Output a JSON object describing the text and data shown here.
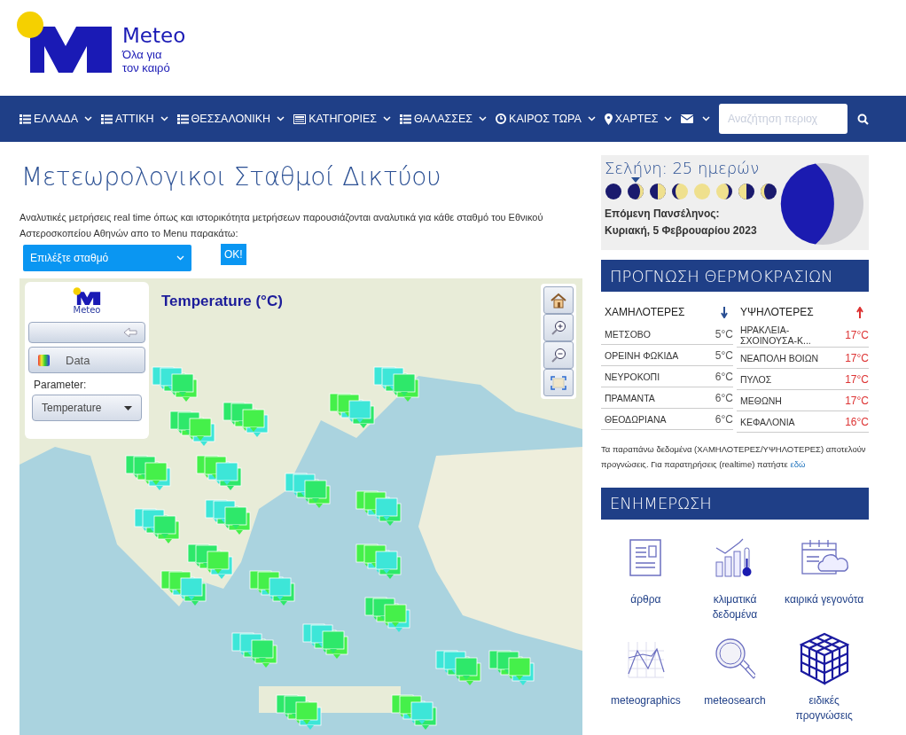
{
  "header": {
    "logo_text": "Meteo",
    "tagline_lines": [
      "Όλα για",
      "τον καιρό"
    ]
  },
  "nav": {
    "items": [
      {
        "kind": "list",
        "label": "ΕΛΛΑΔΑ"
      },
      {
        "kind": "list",
        "label": "ΑΤΤΙΚΗ"
      },
      {
        "kind": "list",
        "label": "ΘΕΣΣΑΛΟΝΙΚΗ"
      },
      {
        "kind": "newspaper",
        "label": "ΚΑΤΗΓΟΡΙΕΣ"
      },
      {
        "kind": "list",
        "label": "ΘΑΛΑΣΣΕΣ"
      },
      {
        "kind": "clock",
        "label": "ΚΑΙΡΟΣ ΤΩΡΑ"
      },
      {
        "kind": "pin",
        "label": "ΧΑΡΤΕΣ"
      },
      {
        "kind": "envelope"
      }
    ],
    "search": {
      "placeholder": "Αναζήτηση περιοχ"
    }
  },
  "page": {
    "title": "Μετεωρολογικοι Σταθμοί Δικτύου",
    "intro": "Αναλυτικές μετρήσεις real time όπως και ιστορικότητα μετρήσεων παρουσιάζονται αναλυτικά για κάθε σταθμό του Εθνικού Αστεροσκοπείου Αθηνών απο το Menu παρακάτω:",
    "station_select": {
      "value": "Επιλέξτε σταθμό"
    },
    "ok_button": "OK!"
  },
  "map": {
    "title": "Temperature (°C)",
    "panel": {
      "logo_text": "Meteo",
      "data_button": "Data",
      "parameter_label": "Parameter:",
      "parameter_value": "Temperature"
    }
  },
  "moon": {
    "title": "Σελήνη: 25 ημερών",
    "phases": [
      {
        "kind": "new",
        "selected": false
      },
      {
        "kind": "waxing-crescent",
        "selected": true
      },
      {
        "kind": "first-quarter",
        "selected": false
      },
      {
        "kind": "waxing-gibbous",
        "selected": false
      },
      {
        "kind": "full",
        "selected": false
      },
      {
        "kind": "waning-gibbous",
        "selected": false
      },
      {
        "kind": "last-quarter",
        "selected": false
      },
      {
        "kind": "waning-crescent",
        "selected": false
      }
    ],
    "next_full_label": "Επόμενη Πανσέληνος:",
    "next_full_date": "Κυριακή, 5 Φεβρουαρίου 2023"
  },
  "forecast": {
    "title": "ΠΡΟΓΝΩΣΗ ΘΕΡΜΟΚΡΑΣΙΩΝ",
    "lowest": {
      "heading": "ΧΑΜΗΛΟΤΕΡΕΣ",
      "rows": [
        {
          "place": "ΜΕΤΣΟΒΟ",
          "temp": "5°C"
        },
        {
          "place": "ΟΡΕΙΝΗ ΦΩΚΙΔΑ",
          "temp": "5°C"
        },
        {
          "place": "ΝΕΥΡΟΚΟΠΙ",
          "temp": "6°C"
        },
        {
          "place": "ΠΡΑΜΑΝΤΑ",
          "temp": "6°C"
        },
        {
          "place": "ΘΕΟΔΩΡΙΑΝΑ",
          "temp": "6°C"
        }
      ]
    },
    "highest": {
      "heading": "ΥΨΗΛΟΤΕΡΕΣ",
      "rows": [
        {
          "place": "ΗΡΑΚΛΕΙΑ-ΣΧΟΙΝΟΥΣΑ-Κ...",
          "temp": "17°C"
        },
        {
          "place": "ΝΕΑΠΟΛΗ ΒΟΙΩΝ",
          "temp": "17°C"
        },
        {
          "place": "ΠΥΛΟΣ",
          "temp": "17°C"
        },
        {
          "place": "ΜΕΘΩΝΗ",
          "temp": "17°C"
        },
        {
          "place": "ΚΕΦΑΛΟΝΙΑ",
          "temp": "16°C"
        }
      ]
    },
    "note": "Τα παραπάνω δεδομένα (ΧΑΜΗΛΟΤΕΡΕΣ/ΥΨΗΛΟΤΕΡΕΣ) αποτελούν προγνώσεις. Για παρατηρήσεις (realtime) πατήστε",
    "note_link": "εδώ"
  },
  "updates": {
    "title": "ΕΝΗΜΕΡΩΣΗ",
    "items": [
      {
        "kind": "article",
        "label": "άρθρα"
      },
      {
        "kind": "climate",
        "label": "κλιματικά δεδομένα"
      },
      {
        "kind": "calendar",
        "label": "καιρικά γεγονότα"
      },
      {
        "kind": "graph",
        "label": "meteographics"
      },
      {
        "kind": "magnifier",
        "label": "meteosearch"
      },
      {
        "kind": "cube",
        "label": "ειδικές προγνώσεις"
      }
    ]
  }
}
